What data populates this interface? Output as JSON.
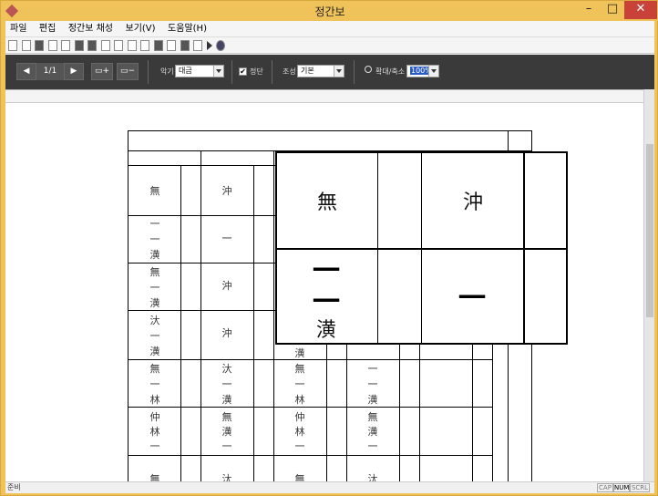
{
  "window": {
    "title": "정간보"
  },
  "menu": [
    "파일",
    "편집",
    "정간보 채성",
    "보기(V)",
    "도움말(H)"
  ],
  "preview": {
    "prev": "◀",
    "page": "1/1",
    "next": "▶",
    "add_page": "▭+",
    "remove_page": "▭−",
    "instrument_label": "악기",
    "instrument_value": "대금",
    "jeongdan_label": "정단",
    "jeongdan_checked": "✔",
    "key_label": "조성",
    "key_value": "기본",
    "zoom_label": "확대/축소",
    "zoom_value": "100%"
  },
  "score": {
    "col1": [
      "無",
      "一",
      "一",
      "潢",
      "無",
      "一",
      "潢",
      "汏",
      "一",
      "潢",
      "無",
      "一",
      "林",
      "仲",
      "林",
      "一",
      "無"
    ],
    "col2": [
      "沖",
      "一",
      "沖",
      "沖",
      "汏",
      "一",
      "潢",
      "無",
      "潢",
      "一",
      "汏"
    ],
    "col3": [
      "潢",
      "無",
      "一",
      "林",
      "仲",
      "林",
      "一",
      "無"
    ],
    "col4": [
      "一",
      "一",
      "潢",
      "無",
      "潢",
      "一",
      "汏"
    ],
    "zoom_cells": [
      "無",
      "沖",
      "一",
      "一",
      "潢",
      "一"
    ]
  },
  "status": {
    "text": "준비",
    "cap": "CAP",
    "num": "NUM",
    "scrl": "SCRL"
  }
}
